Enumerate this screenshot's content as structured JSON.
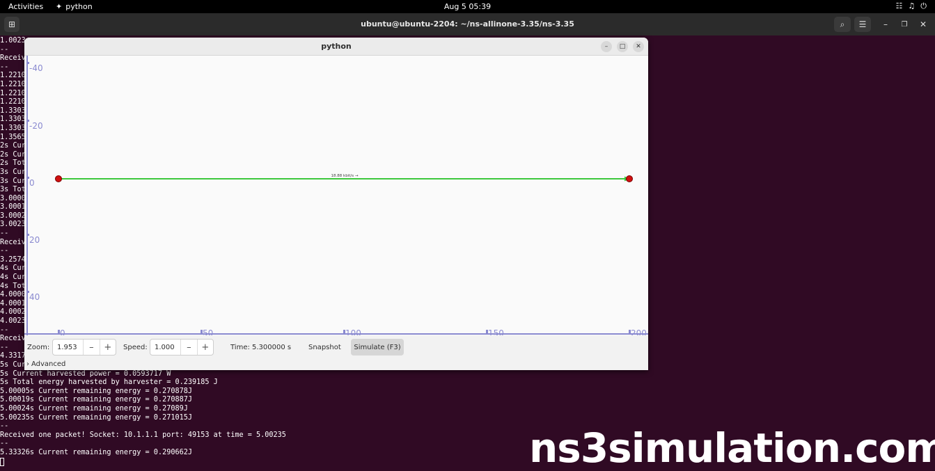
{
  "topbar": {
    "activities": "Activities",
    "app_name": "python",
    "clock": "Aug 5  05:39",
    "tray": [
      "network-icon",
      "volume-icon",
      "power-icon"
    ]
  },
  "terminal": {
    "title": "ubuntu@ubuntu-2204: ~/ns-allinone-3.35/ns-3.35",
    "lines": [
      "1.0023",
      "--",
      "Receiv",
      "--",
      "1.2210",
      "1.2210",
      "1.2210",
      "1.2210",
      "1.3303",
      "1.3303",
      "1.3303",
      "1.3565",
      "2s Cur",
      "2s Cur",
      "2s Tot",
      "3s Cur",
      "3s Cur",
      "3s Tot",
      "3.0000",
      "3.0001",
      "3.0002",
      "3.0023",
      "--",
      "Receiv",
      "--",
      "3.2574",
      "4s Cur",
      "4s Cur",
      "4s Tot",
      "4.0000",
      "4.0001",
      "4.0002",
      "4.0023",
      "--",
      "Receiv",
      "--",
      "4.3317",
      "5s Cur",
      "5s Current harvested power = 0.0593717 W",
      "5s Total energy harvested by harvester = 0.239185 J",
      "5.00005s Current remaining energy = 0.270878J",
      "5.00019s Current remaining energy = 0.270887J",
      "5.00024s Current remaining energy = 0.27089J",
      "5.00235s Current remaining energy = 0.271015J",
      "--",
      "Received one packet! Socket: 10.1.1.1 port: 49153 at time = 5.00235",
      "--",
      "5.33326s Current remaining energy = 0.290662J"
    ]
  },
  "pyviz": {
    "title": "python",
    "y_ticks": [
      "-40",
      "-20",
      "0",
      "20",
      "40"
    ],
    "x_ticks": [
      "0",
      "50",
      "100",
      "150",
      "200"
    ],
    "link_label": "18.88 kbit/s →",
    "colors": {
      "link": "#3cc83c",
      "node": "#d01010",
      "axis": "#8a8ad0"
    },
    "controls": {
      "zoom_label": "Zoom:",
      "zoom_value": "1.953",
      "speed_label": "Speed:",
      "speed_value": "1.000",
      "time_text": "Time: 5.300000 s",
      "snapshot_label": "Snapshot",
      "simulate_label": "Simulate (F3)",
      "advanced_label": "Advanced",
      "minus": "–",
      "plus": "+"
    }
  },
  "watermark": "ns3simulation.com"
}
